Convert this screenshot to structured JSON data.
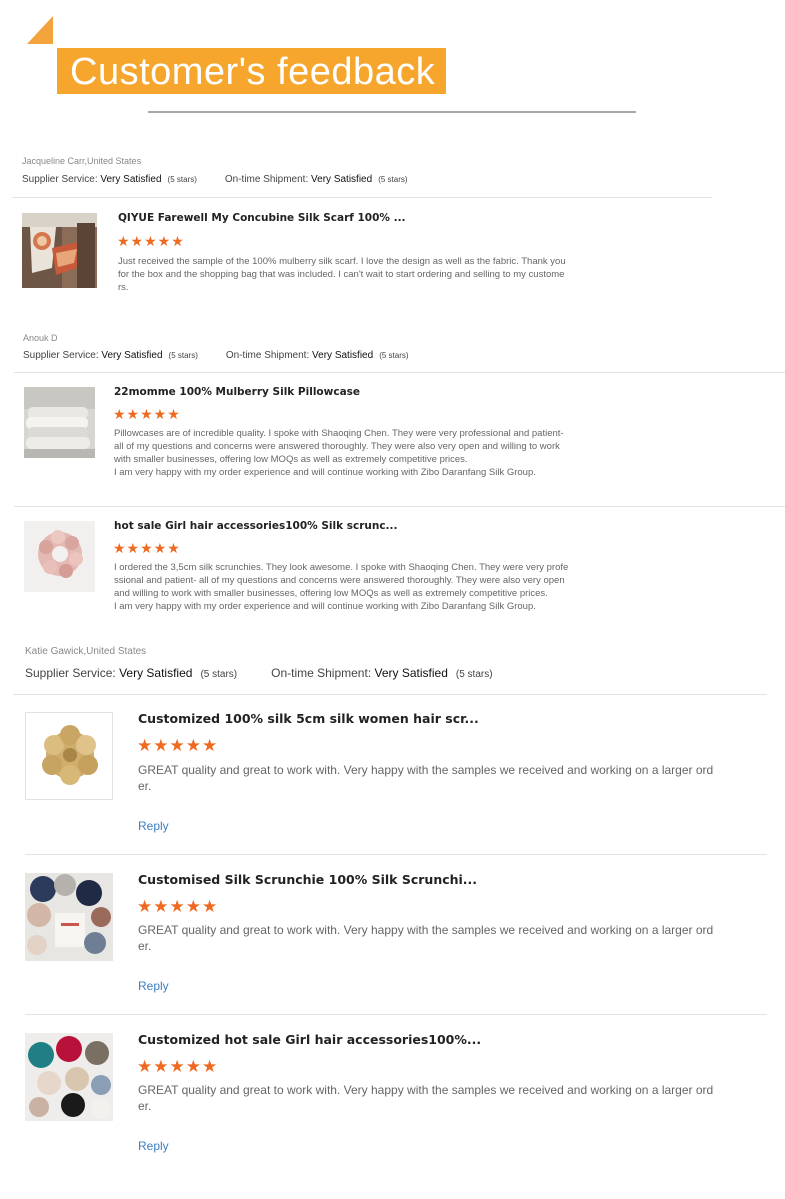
{
  "title": "Customer's feedback",
  "sections": [
    {
      "reviewer": "Jacqueline Carr,United States",
      "supplier_label": "Supplier Service:",
      "supplier_value": "Very Satisfied",
      "supplier_stars": "(5 stars)",
      "shipment_label": "On-time Shipment:",
      "shipment_value": "Very Satisfied",
      "shipment_stars": "(5 stars)",
      "items": [
        {
          "product": "QIYUE Farewell My Concubine Silk Scarf 100% ...",
          "rating": 5,
          "stars": "★★★★★",
          "review_lines": [
            "Just received the sample of the 100% mulberry silk scarf. I love the design as well as the fabric. Thank you",
            "for the box and the shopping bag that was included. I can't wait to start ordering and selling to my custome",
            "rs."
          ]
        }
      ]
    },
    {
      "reviewer": "Anouk D",
      "supplier_label": "Supplier Service:",
      "supplier_value": "Very Satisfied",
      "supplier_stars": "(5 stars)",
      "shipment_label": "On-time Shipment:",
      "shipment_value": "Very Satisfied",
      "shipment_stars": "(5 stars)",
      "items": [
        {
          "product": "22momme 100% Mulberry Silk Pillowcase",
          "rating": 5,
          "stars": "★★★★★",
          "review_lines": [
            "Pillowcases are of incredible quality. I spoke with Shaoqing Chen. They were very professional and patient-",
            "all of my questions and concerns were answered thoroughly. They were also very open and willing to work",
            "with smaller businesses, offering low MOQs as well as extremely competitive prices.",
            "I am very happy with my order experience and will continue working with Zibo Daranfang Silk Group."
          ]
        },
        {
          "product": "hot sale Girl hair accessories100% Silk scrunc...",
          "rating": 5,
          "stars": "★★★★★",
          "review_lines": [
            "I ordered the 3,5cm silk scrunchies. They look awesome. I spoke with Shaoqing Chen. They were very profe",
            "ssional and patient- all of my questions and concerns were answered thoroughly. They were also very open",
            "and willing to work with smaller businesses, offering low MOQs as well as extremely competitive prices.",
            "I am very happy with my order experience and will continue working with Zibo Daranfang Silk Group."
          ]
        }
      ]
    },
    {
      "reviewer": "Katie Gawick,United States",
      "supplier_label": "Supplier Service:",
      "supplier_value": "Very Satisfied",
      "supplier_stars": "(5 stars)",
      "shipment_label": "On-time Shipment:",
      "shipment_value": "Very Satisfied",
      "shipment_stars": "(5 stars)",
      "items": [
        {
          "product": "Customized 100% silk 5cm silk women hair scr...",
          "rating": 5,
          "stars": "★★★★★",
          "review_lines": [
            "GREAT quality and great to work with. Very happy with the samples we received and working on a larger ord",
            "er."
          ],
          "reply": "Reply"
        },
        {
          "product": "Customised Silk Scrunchie 100% Silk Scrunchi...",
          "rating": 5,
          "stars": "★★★★★",
          "review_lines": [
            "GREAT quality and great to work with. Very happy with the samples we received and working on a larger ord",
            "er."
          ],
          "reply": "Reply"
        },
        {
          "product": "Customized hot sale Girl hair accessories100%...",
          "rating": 5,
          "stars": "★★★★★",
          "review_lines": [
            "GREAT quality and great to work with. Very happy with the samples we received and working on a larger ord",
            "er."
          ],
          "reply": "Reply"
        }
      ]
    }
  ]
}
